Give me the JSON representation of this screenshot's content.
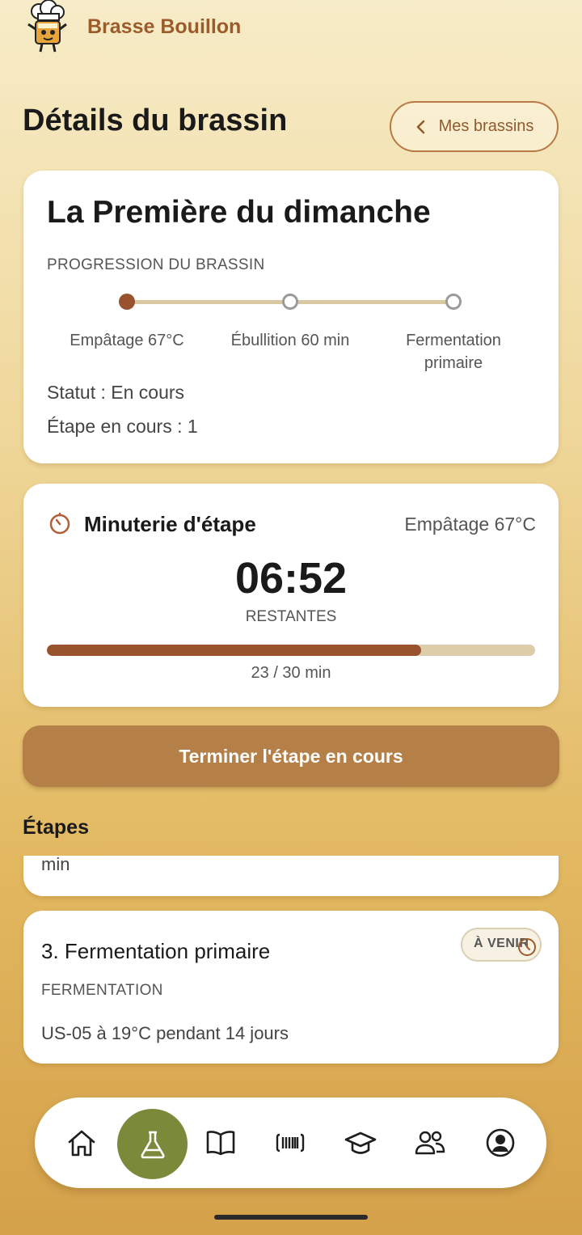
{
  "app": {
    "name": "Brasse Bouillon"
  },
  "header": {
    "title": "Détails du brassin",
    "back_label": "Mes brassins"
  },
  "brew": {
    "name": "La Première du dimanche",
    "progress_label": "PROGRESSION DU BRASSIN",
    "steps": [
      {
        "label": "Empâtage 67°C",
        "state": "done"
      },
      {
        "label": "Ébullition 60 min",
        "state": "todo"
      },
      {
        "label": "Fermentation primaire",
        "state": "todo"
      }
    ],
    "status": "Statut : En cours",
    "current_step": "Étape en cours : 1"
  },
  "timer": {
    "title": "Minuterie d'étape",
    "step_name": "Empâtage 67°C",
    "value": "06:52",
    "remaining_label": "RESTANTES",
    "progress_fraction": 0.767,
    "caption": "23 / 30 min"
  },
  "finish_button": "Terminer l'étape en cours",
  "steps_section": {
    "title": "Étapes",
    "partial_text": "min",
    "card": {
      "title": "3. Fermentation primaire",
      "type": "FERMENTATION",
      "description": "US-05 à 19°C pendant 14 jours",
      "badge": "À VENIR"
    }
  },
  "nav": {
    "items": [
      {
        "icon": "home-icon",
        "active": false
      },
      {
        "icon": "flask-icon",
        "active": true
      },
      {
        "icon": "book-icon",
        "active": false
      },
      {
        "icon": "barcode-icon",
        "active": false
      },
      {
        "icon": "graduation-cap-icon",
        "active": false
      },
      {
        "icon": "users-icon",
        "active": false
      },
      {
        "icon": "profile-icon",
        "active": false
      }
    ]
  },
  "colors": {
    "accent_brown": "#98532e",
    "button_brown": "#b57f48",
    "active_tab_green": "#7a8a3a",
    "brand_text": "#9c5b2a"
  }
}
